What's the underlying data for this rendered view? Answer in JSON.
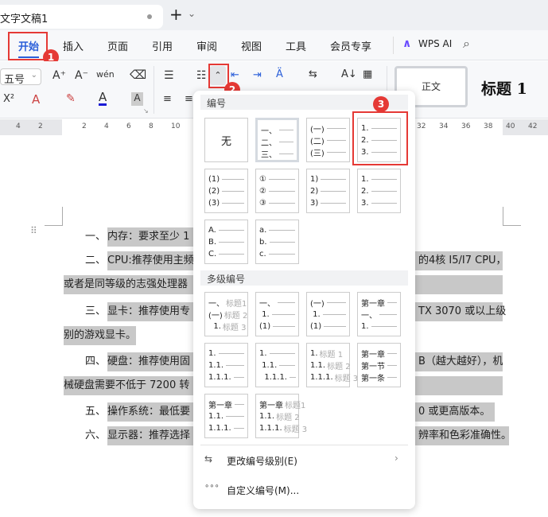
{
  "tab": {
    "title": "文字文稿1",
    "new_tab": "+",
    "chevron": "⌄"
  },
  "menu": {
    "items": [
      "开始",
      "插入",
      "页面",
      "引用",
      "审阅",
      "视图",
      "工具",
      "会员专享"
    ],
    "active": "开始",
    "ai": "WPS AI"
  },
  "toolbar": {
    "font_size": "五号",
    "pinyin": "wén",
    "style_normal": "正文",
    "style_h1": "标题 1",
    "superscript": "X²"
  },
  "badges": [
    "1",
    "2",
    "3"
  ],
  "ruler": {
    "left": [
      "4",
      "2"
    ],
    "main": [
      "2",
      "4",
      "6",
      "8",
      "10"
    ],
    "right": [
      "32",
      "34",
      "36",
      "38",
      "40",
      "42"
    ]
  },
  "document": {
    "lines": [
      {
        "pre": "一、",
        "left": "内存：要求至少 1",
        "right": ""
      },
      {
        "pre": "二、",
        "left": "CPU:推荐使用主频",
        "right": "的4核 I5/I7 CPU，"
      },
      {
        "pre": "",
        "left": "或者是同等级的志强处理器",
        "right": ""
      },
      {
        "pre": "三、",
        "left": "显卡：推荐使用专",
        "right": "TX 3070 或以上级"
      },
      {
        "pre": "",
        "left": "别的游戏显卡。",
        "right": ""
      },
      {
        "pre": "四、",
        "left": "硬盘：推荐使用固",
        "right": "B（越大越好），机"
      },
      {
        "pre": "",
        "left": "械硬盘需要不低于 7200 转",
        "right": ""
      },
      {
        "pre": "五、",
        "left": "操作系统：最低要",
        "right": "0 或更高版本。"
      },
      {
        "pre": "六、",
        "left": "显示器：推荐选择",
        "right": "辨率和色彩准确性。"
      }
    ]
  },
  "dropdown": {
    "numbering_title": "编号",
    "none_label": "无",
    "numbering": [
      [
        [
          "一、"
        ],
        [
          "二、"
        ],
        [
          "三、"
        ]
      ],
      [
        [
          "(一)"
        ],
        [
          "(二)"
        ],
        [
          "(三)"
        ]
      ],
      [
        [
          "1."
        ],
        [
          "2."
        ],
        [
          "3."
        ]
      ],
      [
        [
          "(1)"
        ],
        [
          "(2)"
        ],
        [
          "(3)"
        ]
      ],
      [
        [
          "①"
        ],
        [
          "②"
        ],
        [
          "③"
        ]
      ],
      [
        [
          "1)"
        ],
        [
          "2)"
        ],
        [
          "3)"
        ]
      ],
      [
        [
          "1."
        ],
        [
          "2."
        ],
        [
          "3."
        ]
      ],
      [
        [
          "A."
        ],
        [
          "B."
        ],
        [
          "C."
        ]
      ],
      [
        [
          "a."
        ],
        [
          "b."
        ],
        [
          "c."
        ]
      ]
    ],
    "multilevel_title": "多级编号",
    "multilevel": [
      [
        [
          "一、",
          "标题1"
        ],
        [
          "(一)",
          "标题 2"
        ],
        [
          "  1.",
          "标题 3"
        ]
      ],
      [
        [
          "一、"
        ],
        [
          " 1."
        ],
        [
          "(1)"
        ]
      ],
      [
        [
          "(一)"
        ],
        [
          " 1."
        ],
        [
          "(1)"
        ]
      ],
      [
        [
          "第一章"
        ],
        [
          "一、"
        ],
        [
          "1."
        ]
      ],
      [
        [
          "1."
        ],
        [
          "1.1."
        ],
        [
          "1.1.1."
        ]
      ],
      [
        [
          "1."
        ],
        [
          " 1.1."
        ],
        [
          "  1.1.1."
        ]
      ],
      [
        [
          "1.",
          "标题 1"
        ],
        [
          "1.1.",
          "标题 2"
        ],
        [
          "1.1.1.",
          "标题 3"
        ]
      ],
      [
        [
          "第一章"
        ],
        [
          "第一节"
        ],
        [
          "第一条"
        ]
      ],
      [
        [
          "第一章"
        ],
        [
          "1.1."
        ],
        [
          "1.1.1."
        ]
      ],
      [
        [
          "第一章",
          "标题1"
        ],
        [
          "1.1.",
          "标题 2"
        ],
        [
          "1.1.1.",
          "标题 3"
        ]
      ]
    ],
    "change_level": "更改编号级别(E)",
    "custom": "自定义编号(M)..."
  }
}
